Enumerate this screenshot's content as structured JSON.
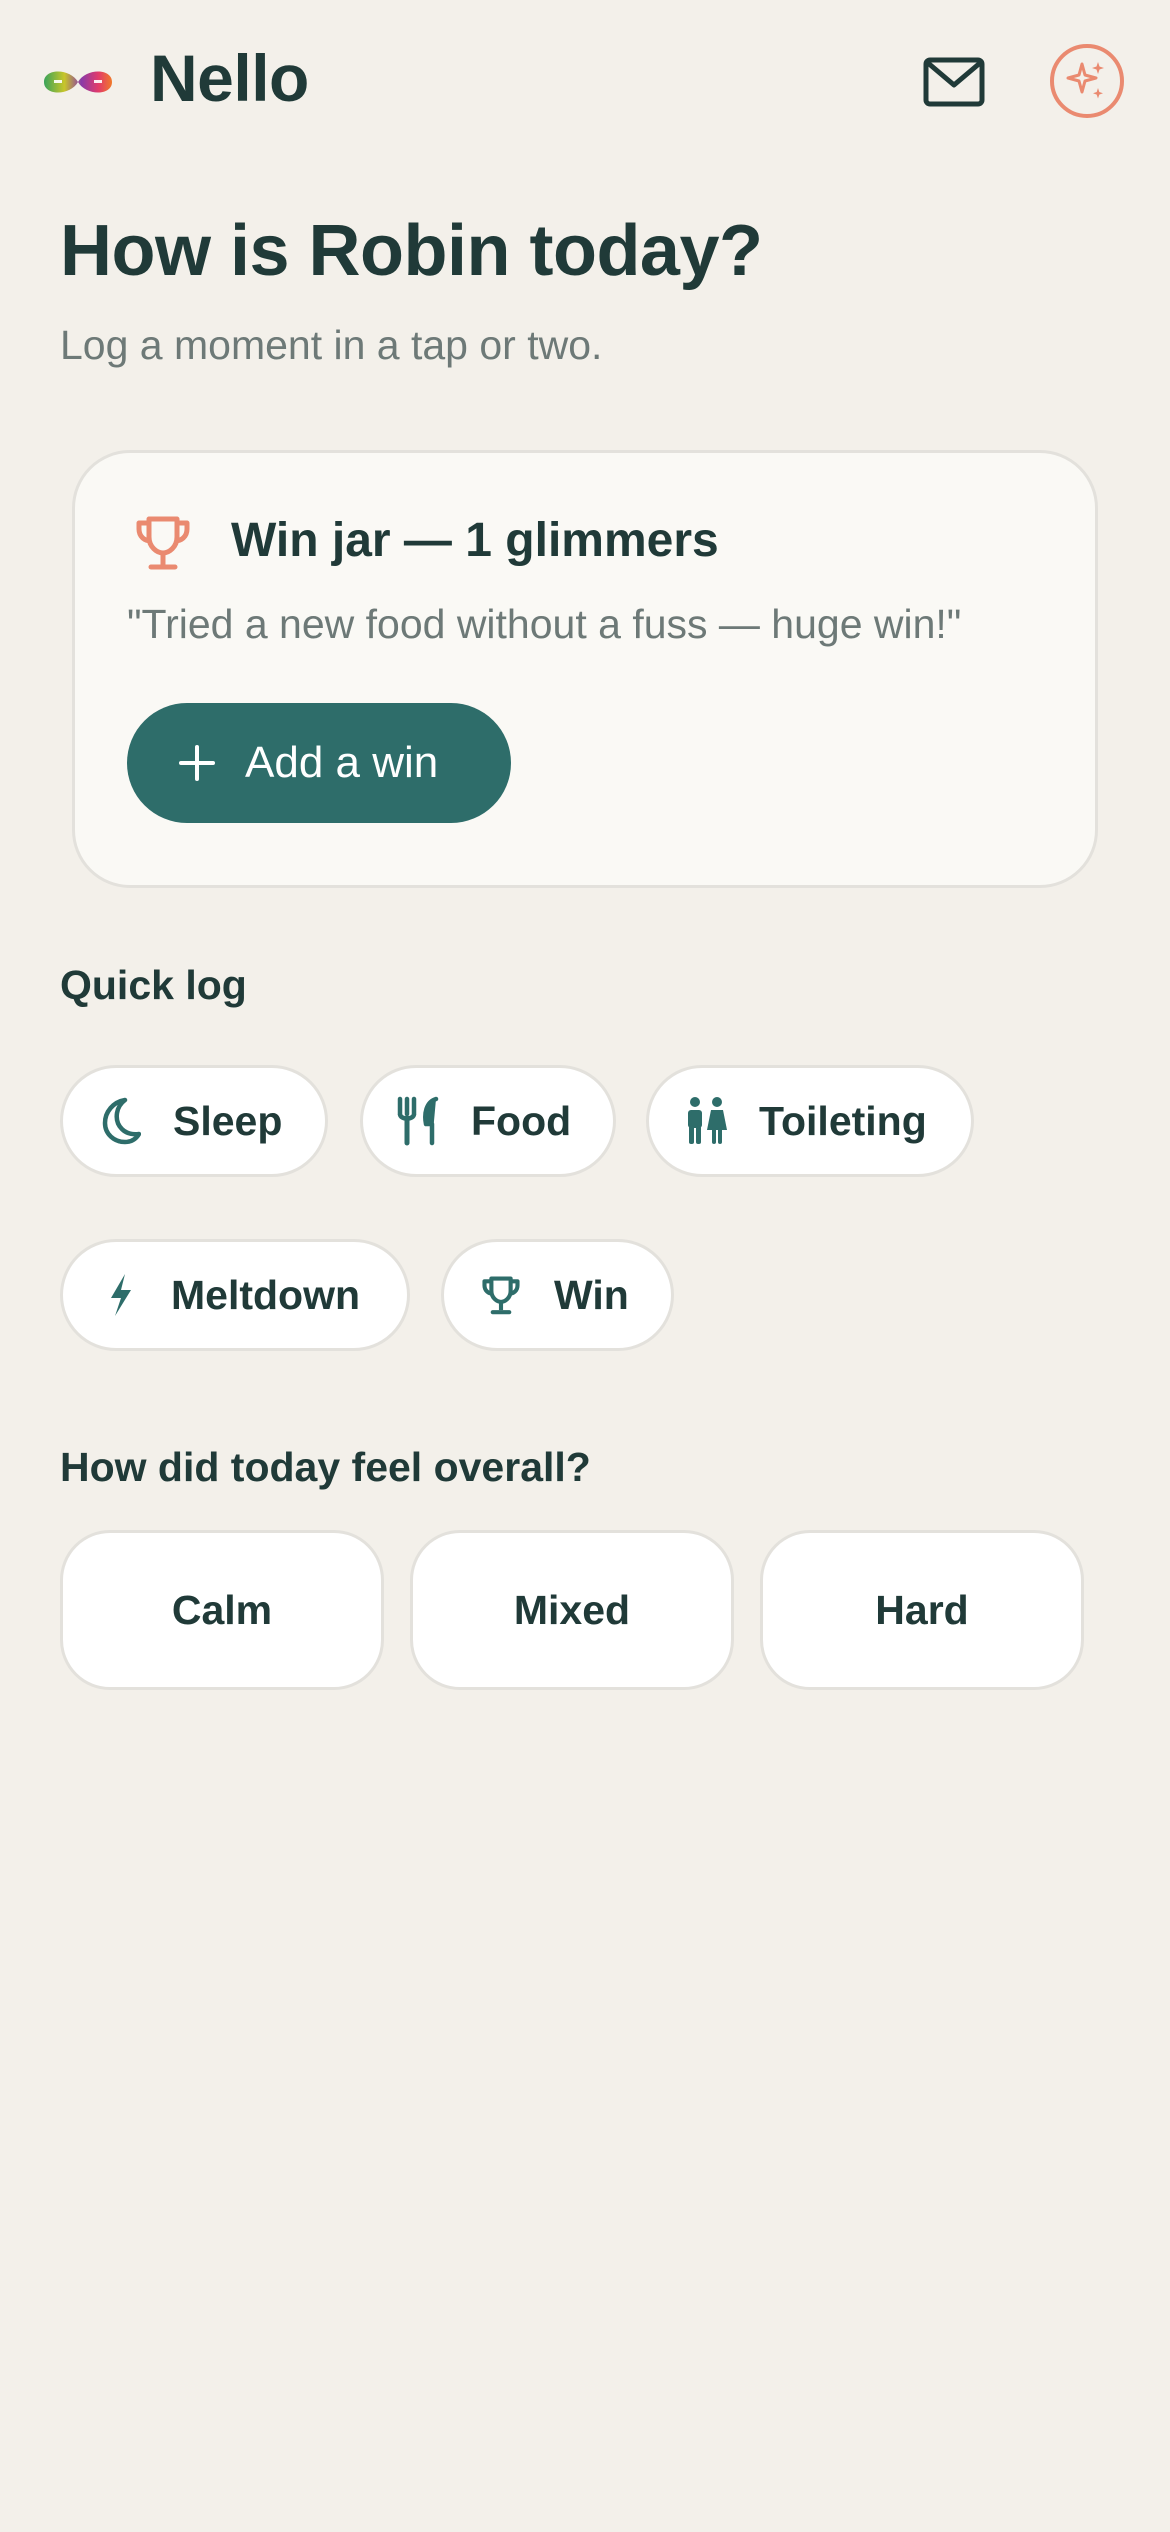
{
  "header": {
    "app_title": "Nello",
    "mail_icon": "mail-icon",
    "sparkle_icon": "sparkle-icon",
    "logo_icon": "infinity-logo-icon"
  },
  "main": {
    "title": "How is Robin today?",
    "subtitle": "Log a moment in a tap or two."
  },
  "win_jar": {
    "icon": "trophy-icon",
    "title": "Win jar — 1 glimmers",
    "quote": "\"Tried a new food without a fuss — huge win!\"",
    "add_button_label": "Add a win",
    "add_icon": "plus-icon"
  },
  "quick_log": {
    "title": "Quick log",
    "items": [
      {
        "label": "Sleep",
        "icon": "moon-icon"
      },
      {
        "label": "Food",
        "icon": "utensils-icon"
      },
      {
        "label": "Toileting",
        "icon": "restroom-icon"
      },
      {
        "label": "Meltdown",
        "icon": "lightning-icon"
      },
      {
        "label": "Win",
        "icon": "trophy-icon"
      }
    ]
  },
  "day_feel": {
    "title": "How did today feel overall?",
    "options": [
      "Calm",
      "Mixed",
      "Hard"
    ]
  },
  "colors": {
    "background": "#f3f0ea",
    "primary": "#2e6d6a",
    "accent": "#ea8a70",
    "text": "#203a38",
    "muted_text": "#6d7977"
  }
}
